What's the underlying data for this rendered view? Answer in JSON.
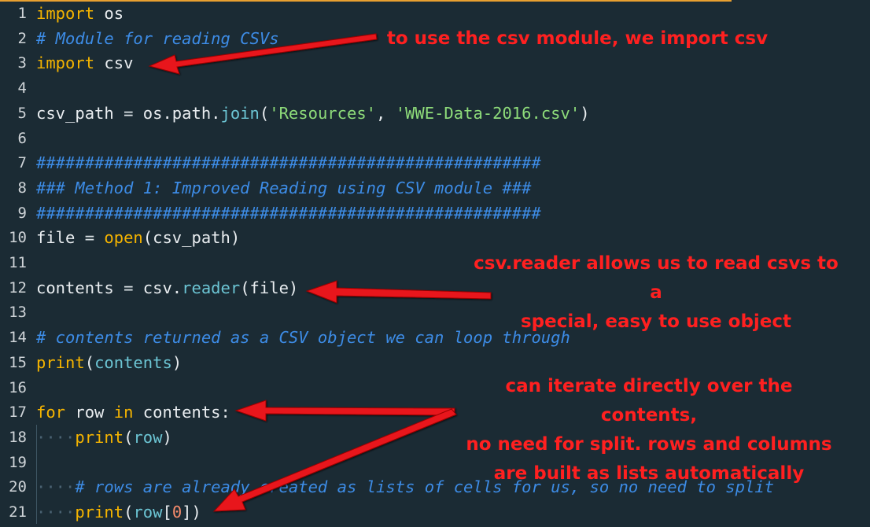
{
  "editor": {
    "lines": [
      {
        "n": "1",
        "tokens": [
          {
            "t": "import",
            "c": "kw"
          },
          {
            "t": " os",
            "c": "plain"
          }
        ]
      },
      {
        "n": "2",
        "tokens": [
          {
            "t": "# Module for reading CSVs",
            "c": "cmt"
          }
        ]
      },
      {
        "n": "3",
        "tokens": [
          {
            "t": "import",
            "c": "kw"
          },
          {
            "t": " csv",
            "c": "plain"
          }
        ]
      },
      {
        "n": "4",
        "tokens": []
      },
      {
        "n": "5",
        "tokens": [
          {
            "t": "csv_path",
            "c": "plain"
          },
          {
            "t": " = ",
            "c": "op"
          },
          {
            "t": "os.path.",
            "c": "plain"
          },
          {
            "t": "join",
            "c": "fn"
          },
          {
            "t": "(",
            "c": "plain"
          },
          {
            "t": "'Resources'",
            "c": "str"
          },
          {
            "t": ", ",
            "c": "plain"
          },
          {
            "t": "'WWE-Data-2016.csv'",
            "c": "str"
          },
          {
            "t": ")",
            "c": "plain"
          }
        ]
      },
      {
        "n": "6",
        "tokens": []
      },
      {
        "n": "7",
        "tokens": [
          {
            "t": "####################################################",
            "c": "cmt"
          }
        ]
      },
      {
        "n": "8",
        "tokens": [
          {
            "t": "### Method 1: Improved Reading using CSV module ###",
            "c": "cmt"
          }
        ]
      },
      {
        "n": "9",
        "tokens": [
          {
            "t": "####################################################",
            "c": "cmt"
          }
        ]
      },
      {
        "n": "10",
        "tokens": [
          {
            "t": "file",
            "c": "plain"
          },
          {
            "t": " = ",
            "c": "op"
          },
          {
            "t": "open",
            "c": "kw"
          },
          {
            "t": "(csv_path)",
            "c": "plain"
          }
        ]
      },
      {
        "n": "11",
        "tokens": []
      },
      {
        "n": "12",
        "tokens": [
          {
            "t": "contents",
            "c": "plain"
          },
          {
            "t": " = ",
            "c": "op"
          },
          {
            "t": "csv.",
            "c": "plain"
          },
          {
            "t": "reader",
            "c": "fn"
          },
          {
            "t": "(file)",
            "c": "plain"
          }
        ]
      },
      {
        "n": "13",
        "tokens": []
      },
      {
        "n": "14",
        "tokens": [
          {
            "t": "# contents returned as a CSV object we can loop through",
            "c": "cmt"
          }
        ]
      },
      {
        "n": "15",
        "tokens": [
          {
            "t": "print",
            "c": "kw"
          },
          {
            "t": "(",
            "c": "plain"
          },
          {
            "t": "contents",
            "c": "fn"
          },
          {
            "t": ")",
            "c": "plain"
          }
        ]
      },
      {
        "n": "16",
        "tokens": []
      },
      {
        "n": "17",
        "tokens": [
          {
            "t": "for",
            "c": "kw"
          },
          {
            "t": " row ",
            "c": "plain"
          },
          {
            "t": "in",
            "c": "kw"
          },
          {
            "t": " contents:",
            "c": "plain"
          }
        ]
      },
      {
        "n": "18",
        "tokens": [
          {
            "t": "····",
            "c": "ws"
          },
          {
            "t": "print",
            "c": "kw"
          },
          {
            "t": "(",
            "c": "plain"
          },
          {
            "t": "row",
            "c": "fn"
          },
          {
            "t": ")",
            "c": "plain"
          }
        ]
      },
      {
        "n": "19",
        "tokens": []
      },
      {
        "n": "20",
        "tokens": [
          {
            "t": "····",
            "c": "ws"
          },
          {
            "t": "# rows are already created as lists of cells for us, so no need to split",
            "c": "cmt"
          }
        ]
      },
      {
        "n": "21",
        "tokens": [
          {
            "t": "····",
            "c": "ws"
          },
          {
            "t": "print",
            "c": "kw"
          },
          {
            "t": "(",
            "c": "plain"
          },
          {
            "t": "row",
            "c": "fn"
          },
          {
            "t": "[",
            "c": "plain"
          },
          {
            "t": "0",
            "c": "num"
          },
          {
            "t": "])",
            "c": "plain"
          }
        ]
      }
    ]
  },
  "annotations": {
    "import_note": "to use the csv module, we import csv",
    "reader_note_line1": "csv.reader allows us to read csvs to a",
    "reader_note_line2": "special, easy to use object",
    "iterate_note_line1": "can iterate directly over the contents,",
    "iterate_note_line2": "no need for split. rows and columns",
    "iterate_note_line3": "are built as lists automatically"
  },
  "colors": {
    "background": "#1b2b34",
    "keyword": "#f5b400",
    "function": "#6cc5d4",
    "string": "#8edc7a",
    "comment": "#3d8ce6",
    "annotation": "#ff2020"
  }
}
